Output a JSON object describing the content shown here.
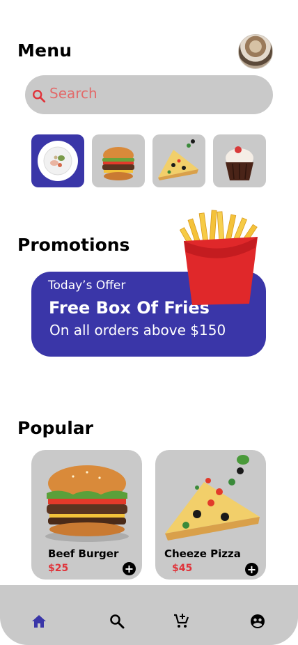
{
  "header": {
    "title": "Menu"
  },
  "search": {
    "placeholder": "Search"
  },
  "categories": [
    {
      "name": "plate",
      "active": true
    },
    {
      "name": "burger",
      "active": false
    },
    {
      "name": "pizza",
      "active": false
    },
    {
      "name": "cupcake",
      "active": false
    }
  ],
  "promotions": {
    "title": "Promotions",
    "label": "Today’s Offer",
    "headline": "Free Box Of Fries",
    "subtitle": "On all orders above $150"
  },
  "popular": {
    "title": "Popular",
    "items": [
      {
        "name": "Beef Burger",
        "price": "$25"
      },
      {
        "name": "Cheeze Pizza",
        "price": "$45"
      }
    ]
  },
  "nav": {
    "items": [
      "home-icon",
      "search-icon",
      "cart-icon",
      "profile-icon"
    ],
    "active": "home-icon"
  },
  "colors": {
    "accent": "#3a36a8",
    "surface": "#c9c9c9",
    "price": "#e0333a",
    "placeholder": "#e26b6b"
  }
}
